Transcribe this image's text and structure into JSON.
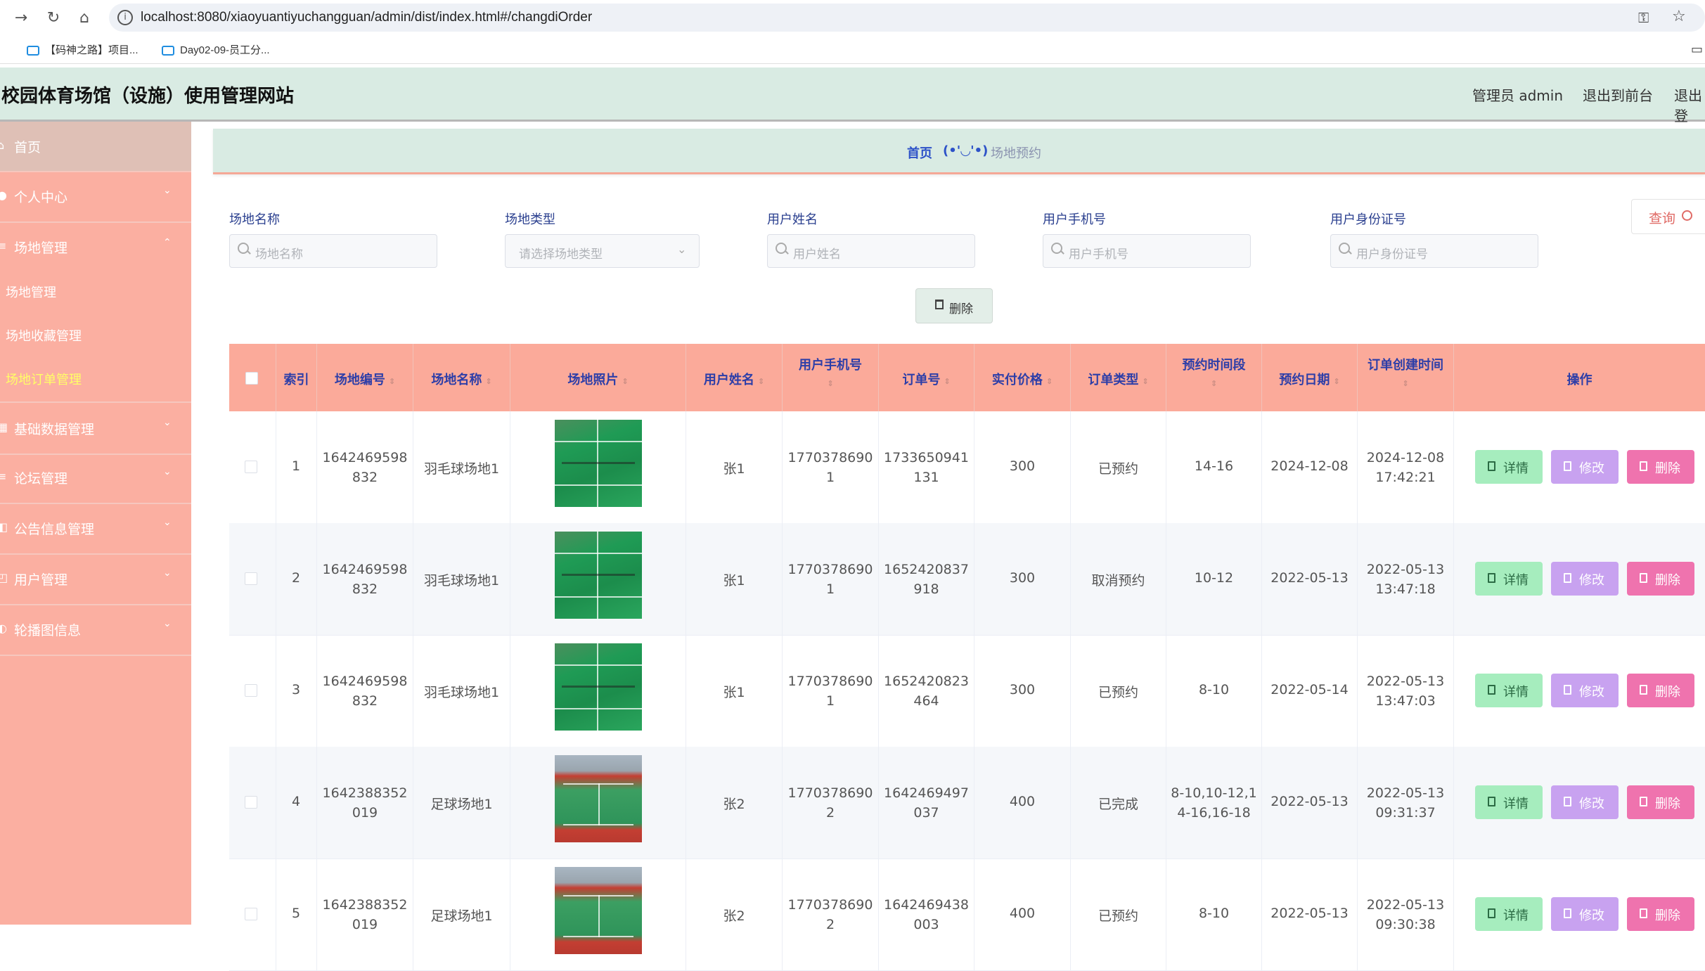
{
  "browser": {
    "url": "localhost:8080/xiaoyuantiyuchangguan/admin/dist/index.html#/changdiOrder",
    "bookmarks": [
      "【码神之路】项目...",
      "Day02-09-员工分..."
    ]
  },
  "header": {
    "site_title": "校园体育场馆（设施）使用管理网站",
    "user_label": "管理员 admin",
    "back_label": "退出到前台",
    "logout_label": "退出登"
  },
  "sidebar": {
    "items": [
      {
        "label": "首页"
      },
      {
        "label": "个人中心"
      },
      {
        "label": "场地管理"
      },
      {
        "label": "基础数据管理"
      },
      {
        "label": "论坛管理"
      },
      {
        "label": "公告信息管理"
      },
      {
        "label": "用户管理"
      },
      {
        "label": "轮播图信息"
      }
    ],
    "sub_items": [
      {
        "label": "场地管理"
      },
      {
        "label": "场地收藏管理"
      },
      {
        "label": "场地订单管理"
      }
    ]
  },
  "breadcrumb": {
    "home": "首页",
    "face": "(•'◡'•)",
    "current": "场地预约"
  },
  "search": {
    "fields": [
      {
        "label": "场地名称",
        "placeholder": "场地名称"
      },
      {
        "label": "场地类型",
        "placeholder": "请选择场地类型"
      },
      {
        "label": "用户姓名",
        "placeholder": "用户姓名"
      },
      {
        "label": "用户手机号",
        "placeholder": "用户手机号"
      },
      {
        "label": "用户身份证号",
        "placeholder": "用户身份证号"
      }
    ],
    "query_label": "查询",
    "delete_label": "删除"
  },
  "table": {
    "headers": [
      "索引",
      "场地编号",
      "场地名称",
      "场地照片",
      "用户姓名",
      "用户手机号",
      "订单号",
      "实付价格",
      "订单类型",
      "预约时间段",
      "预约日期",
      "订单创建时间",
      "操作"
    ],
    "actions": {
      "detail": "详情",
      "edit": "修改",
      "delete": "删除"
    },
    "rows": [
      {
        "index": "1",
        "code_a": "1642469598",
        "code_b": "832",
        "name": "羽毛球场地1",
        "photo": "green",
        "user": "张1",
        "phone_a": "1770378690",
        "phone_b": "1",
        "order_a": "1733650941",
        "order_b": "131",
        "price": "300",
        "type": "已预约",
        "slot_a": "14-16",
        "slot_b": "",
        "date": "2024-12-08",
        "created_a": "2024-12-08",
        "created_b": "17:42:21"
      },
      {
        "index": "2",
        "code_a": "1642469598",
        "code_b": "832",
        "name": "羽毛球场地1",
        "photo": "green",
        "user": "张1",
        "phone_a": "1770378690",
        "phone_b": "1",
        "order_a": "1652420837",
        "order_b": "918",
        "price": "300",
        "type": "取消预约",
        "slot_a": "10-12",
        "slot_b": "",
        "date": "2022-05-13",
        "created_a": "2022-05-13",
        "created_b": "13:47:18"
      },
      {
        "index": "3",
        "code_a": "1642469598",
        "code_b": "832",
        "name": "羽毛球场地1",
        "photo": "green",
        "user": "张1",
        "phone_a": "1770378690",
        "phone_b": "1",
        "order_a": "1652420823",
        "order_b": "464",
        "price": "300",
        "type": "已预约",
        "slot_a": "8-10",
        "slot_b": "",
        "date": "2022-05-14",
        "created_a": "2022-05-13",
        "created_b": "13:47:03"
      },
      {
        "index": "4",
        "code_a": "1642388352",
        "code_b": "019",
        "name": "足球场地1",
        "photo": "red",
        "user": "张2",
        "phone_a": "1770378690",
        "phone_b": "2",
        "order_a": "1642469497",
        "order_b": "037",
        "price": "400",
        "type": "已完成",
        "slot_a": "8-10,10-12,1",
        "slot_b": "4-16,16-18",
        "date": "2022-05-13",
        "created_a": "2022-05-13",
        "created_b": "09:31:37"
      },
      {
        "index": "5",
        "code_a": "1642388352",
        "code_b": "019",
        "name": "足球场地1",
        "photo": "red",
        "user": "张2",
        "phone_a": "1770378690",
        "phone_b": "2",
        "order_a": "1642469438",
        "order_b": "003",
        "price": "400",
        "type": "已预约",
        "slot_a": "8-10",
        "slot_b": "",
        "date": "2022-05-13",
        "created_a": "2022-05-13",
        "created_b": "09:30:38"
      }
    ]
  },
  "colors": {
    "sidebar": "#fbafa1",
    "header": "#d9ebe3",
    "table_header": "#fbaa9a",
    "active_submenu": "#ffff66"
  }
}
